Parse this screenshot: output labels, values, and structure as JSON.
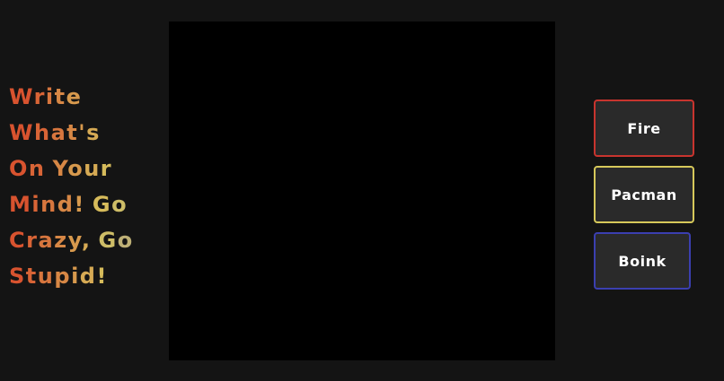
{
  "headline": {
    "lines": [
      [
        "Write"
      ],
      [
        "What's"
      ],
      [
        "On",
        "Your"
      ],
      [
        "Mind!",
        "Go"
      ],
      [
        "Crazy,",
        "Go"
      ],
      [
        "Stupid!"
      ]
    ],
    "colors": {
      "start": "#d8532f",
      "mid": "#d6c45f",
      "end": "#6d6fc2"
    }
  },
  "modes": {
    "fire": {
      "label": "Fire",
      "color": "#c8342e"
    },
    "pacman": {
      "label": "Pacman",
      "color": "#d6c85a"
    },
    "boink": {
      "label": "Boink",
      "color": "#3b3fb0"
    }
  }
}
